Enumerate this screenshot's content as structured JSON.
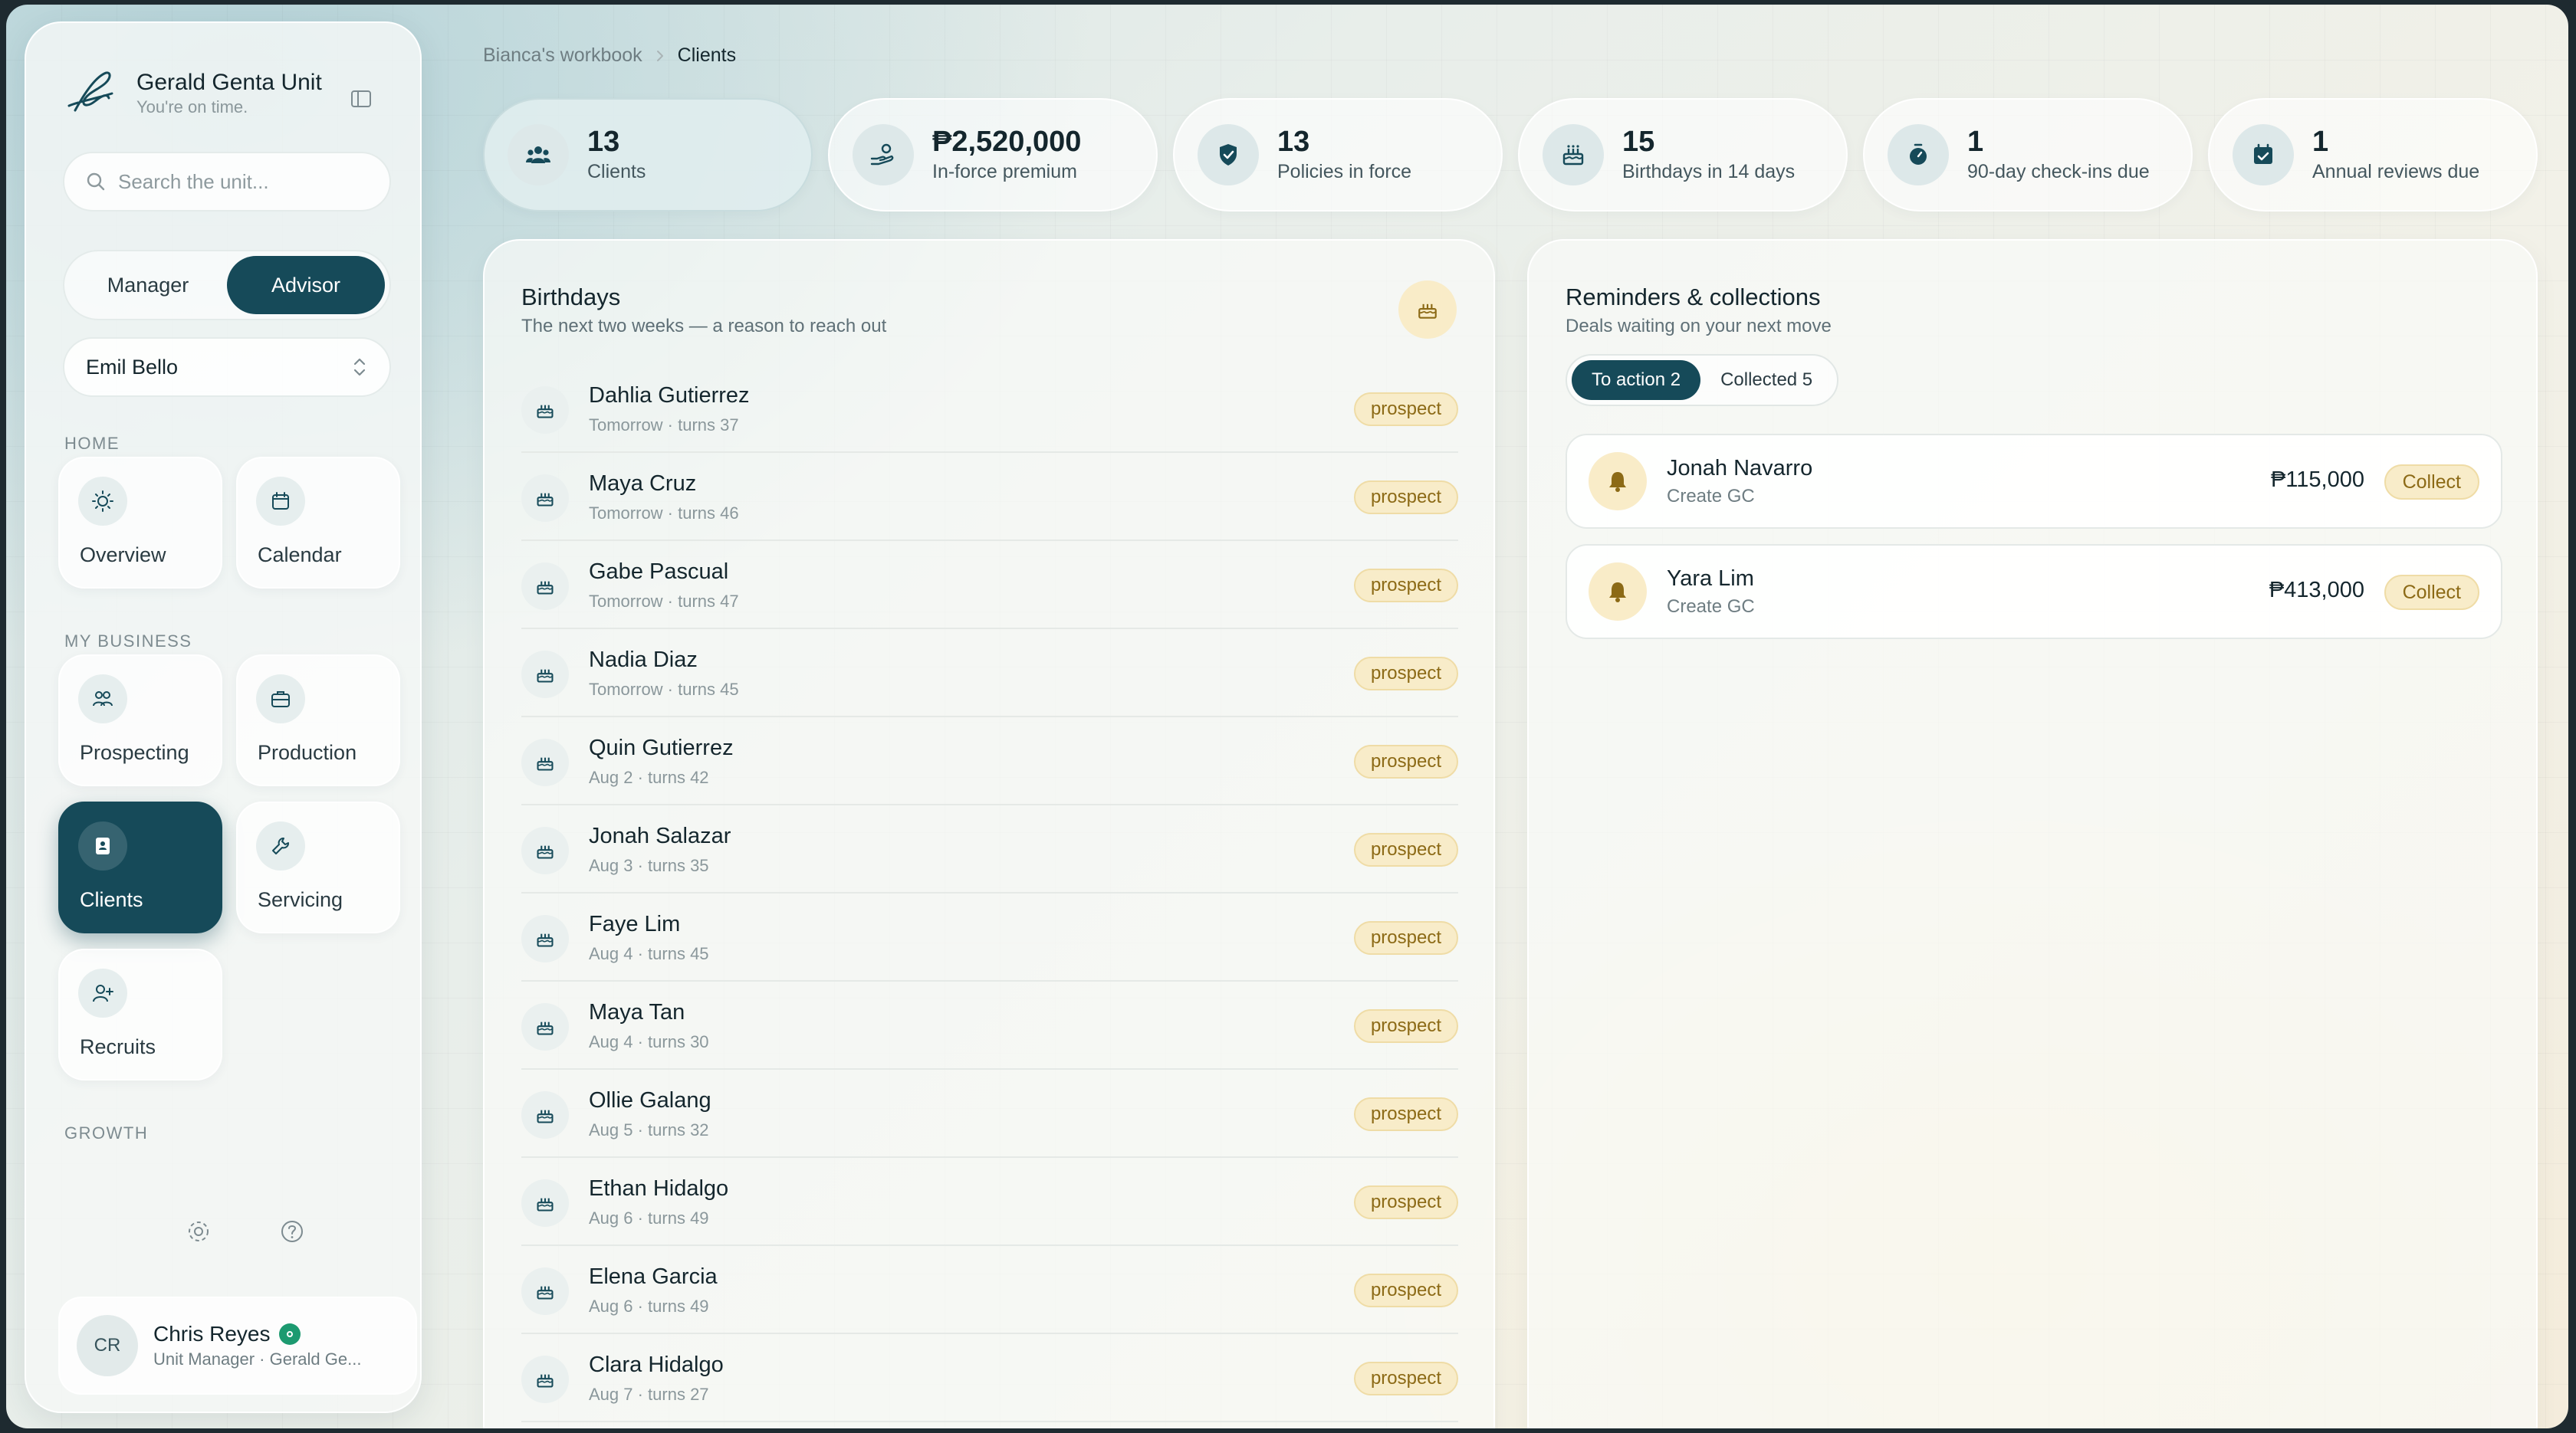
{
  "sidebar": {
    "brand_title": "Gerald Genta Unit",
    "brand_tagline": "You're on time.",
    "search_placeholder": "Search the unit...",
    "roles": [
      "Manager",
      "Advisor"
    ],
    "active_role": "Advisor",
    "selected_advisor": "Emil Bello",
    "sections": {
      "home": "HOME",
      "my_business": "MY BUSINESS",
      "growth": "GROWTH"
    },
    "nav": {
      "overview": "Overview",
      "calendar": "Calendar",
      "prospecting": "Prospecting",
      "production": "Production",
      "clients": "Clients",
      "servicing": "Servicing",
      "recruits": "Recruits"
    },
    "active_nav": "Clients",
    "profile": {
      "initials": "CR",
      "name": "Chris Reyes",
      "role": "Unit Manager · Gerald Ge..."
    }
  },
  "breadcrumb": {
    "parent": "Bianca's workbook",
    "current": "Clients"
  },
  "stats": [
    {
      "value": "13",
      "label": "Clients",
      "icon": "people-icon"
    },
    {
      "value": "₱2,520,000",
      "label": "In-force premium",
      "icon": "hand-coin-icon"
    },
    {
      "value": "13",
      "label": "Policies in force",
      "icon": "shield-check-icon"
    },
    {
      "value": "15",
      "label": "Birthdays in 14 days",
      "icon": "cake-icon"
    },
    {
      "value": "1",
      "label": "90-day check-ins due",
      "icon": "stopwatch-icon"
    },
    {
      "value": "1",
      "label": "Annual reviews due",
      "icon": "calendar-check-icon"
    }
  ],
  "birthdays": {
    "title": "Birthdays",
    "subtitle": "The next two weeks — a reason to reach out",
    "items": [
      {
        "name": "Dahlia Gutierrez",
        "sub": "Tomorrow · turns 37",
        "tag": "prospect"
      },
      {
        "name": "Maya Cruz",
        "sub": "Tomorrow · turns 46",
        "tag": "prospect"
      },
      {
        "name": "Gabe Pascual",
        "sub": "Tomorrow · turns 47",
        "tag": "prospect"
      },
      {
        "name": "Nadia Diaz",
        "sub": "Tomorrow · turns 45",
        "tag": "prospect"
      },
      {
        "name": "Quin Gutierrez",
        "sub": "Aug 2 · turns 42",
        "tag": "prospect"
      },
      {
        "name": "Jonah Salazar",
        "sub": "Aug 3 · turns 35",
        "tag": "prospect"
      },
      {
        "name": "Faye Lim",
        "sub": "Aug 4 · turns 45",
        "tag": "prospect"
      },
      {
        "name": "Maya Tan",
        "sub": "Aug 4 · turns 30",
        "tag": "prospect"
      },
      {
        "name": "Ollie Galang",
        "sub": "Aug 5 · turns 32",
        "tag": "prospect"
      },
      {
        "name": "Ethan Hidalgo",
        "sub": "Aug 6 · turns 49",
        "tag": "prospect"
      },
      {
        "name": "Elena Garcia",
        "sub": "Aug 6 · turns 49",
        "tag": "prospect"
      },
      {
        "name": "Clara Hidalgo",
        "sub": "Aug 7 · turns 27",
        "tag": "prospect"
      }
    ]
  },
  "reminders": {
    "title": "Reminders & collections",
    "subtitle": "Deals waiting on your next move",
    "tabs": [
      "To action 2",
      "Collected 5"
    ],
    "active_tab": "To action 2",
    "items": [
      {
        "name": "Jonah Navarro",
        "sub": "Create GC",
        "amount": "₱115,000",
        "action": "Collect"
      },
      {
        "name": "Yara Lim",
        "sub": "Create GC",
        "amount": "₱413,000",
        "action": "Collect"
      }
    ]
  },
  "colors": {
    "primary": "#164a59",
    "accent_gold": "#8c6a16",
    "gold_bg": "#f8ecc9",
    "verified_green": "#1c9a70"
  }
}
